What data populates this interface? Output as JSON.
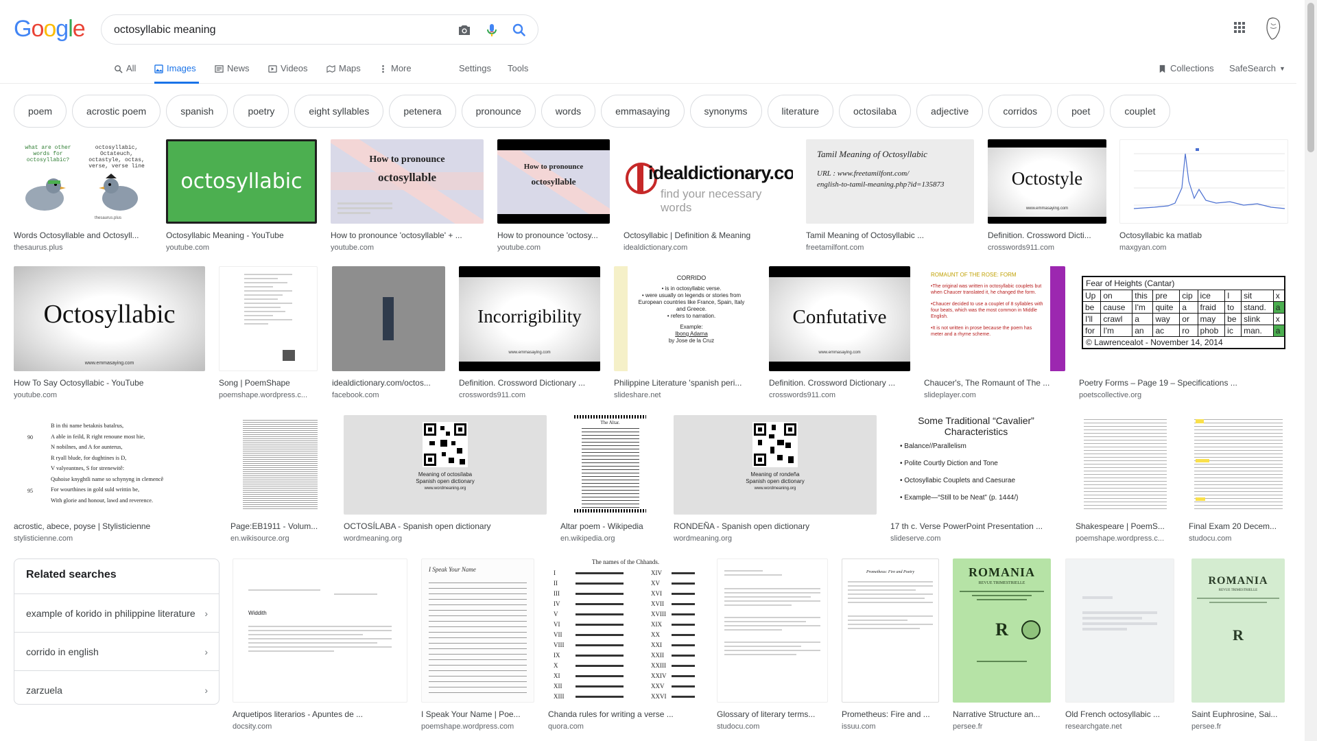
{
  "logo": {
    "g1": "G",
    "o1": "o",
    "o2": "o",
    "g2": "g",
    "l": "l",
    "e": "e"
  },
  "search": {
    "value": "octosyllabic meaning"
  },
  "tabs": [
    {
      "label": "All"
    },
    {
      "label": "Images"
    },
    {
      "label": "News"
    },
    {
      "label": "Videos"
    },
    {
      "label": "Maps"
    },
    {
      "label": "More"
    },
    {
      "label": "Settings"
    },
    {
      "label": "Tools"
    }
  ],
  "header_right": {
    "collections": "Collections",
    "safesearch": "SafeSearch"
  },
  "chips": [
    "poem",
    "acrostic poem",
    "spanish",
    "poetry",
    "eight syllables",
    "petenera",
    "pronounce",
    "words",
    "emmasaying",
    "synonyms",
    "literature",
    "octosilaba",
    "adjective",
    "corridos",
    "poet",
    "couplet"
  ],
  "row1": [
    {
      "title": "Words Octosyllable and Octosyll...",
      "source": "thesaurus.plus",
      "q1": "what are other words for octosyllabic?",
      "q2": "octosyllabic, Octateuch, octastyle, octas, verse, verse line",
      "foot": "thesaurus.plus"
    },
    {
      "title": "Octosyllabic Meaning - YouTube",
      "source": "youtube.com",
      "word": "octosyllabic"
    },
    {
      "title": "How to pronounce 'octosyllable' + ...",
      "source": "youtube.com",
      "line1": "How to pronounce",
      "line2": "octosyllable"
    },
    {
      "title": "How to pronounce 'octosy...",
      "source": "youtube.com",
      "line1": "How to pronounce",
      "line2": "octosyllable"
    },
    {
      "title": "Octosyllabic | Definition & Meaning",
      "source": "idealdictionary.com",
      "brand": "idealdictionary.com",
      "tagline": "find your necessary words"
    },
    {
      "title": "Tamil Meaning of Octosyllabic ...",
      "source": "freetamilfont.com",
      "l1": "Tamil Meaning of Octosyllabic",
      "l2": "URL : www.freetamilfont.com/",
      "l3": "english-to-tamil-meaning.php?id=135873"
    },
    {
      "title": "Definition. Crossword Dicti...",
      "source": "crosswords911.com",
      "word": "Octostyle",
      "foot": "www.emmasaying.com"
    },
    {
      "title": "Octosyllabic ka matlab",
      "source": "maxgyan.com"
    }
  ],
  "row2": [
    {
      "title": "How To Say Octosyllabic - YouTube",
      "source": "youtube.com",
      "word": "Octosyllabic",
      "foot": "www.emmasaying.com"
    },
    {
      "title": "Song | PoemShape",
      "source": "poemshape.wordpress.c..."
    },
    {
      "title": "idealdictionary.com/octos...",
      "source": "facebook.com"
    },
    {
      "title": "Definition. Crossword Dictionary ...",
      "source": "crosswords911.com",
      "word": "Incorrigibility",
      "foot": "www.emmasaying.com"
    },
    {
      "title": "Philippine Literature 'spanish peri...",
      "source": "slideshare.net",
      "head": "CORRIDO",
      "b1": "• is in octosyllabic verse.",
      "b2": "• were usually on legends or stories from European countries like France, Spain, Italy and Greece.",
      "b3": "• refers to narration.",
      "ex": "Example:",
      "ex2": "Ibong Adarna",
      "ex3": "by Jose de la Cruz"
    },
    {
      "title": "Definition. Crossword Dictionary ...",
      "source": "crosswords911.com",
      "word": "Confutative",
      "foot": "www.emmasaying.com"
    },
    {
      "title": "Chaucer's, The Romaunt of The ...",
      "source": "slideplayer.com",
      "head": "ROMAUNT OF THE ROSE: FORM",
      "b1": "•The original was written in octosyllabic couplets but when Chaucer translated it, he changed the form.",
      "b2": "•Chaucer decided to use a couplet of 8 syllables with four beats, which was the most common in Middle English.",
      "b3": "•It is not written in prose because the poem has meter and a rhyme scheme."
    },
    {
      "title": "Poetry Forms – Page 19 – Specifications ...",
      "source": "poetscollective.org",
      "head": "Fear of Heights  (Cantar)",
      "grid": [
        [
          "Up",
          "on",
          "this",
          "pre",
          "cip",
          "ice",
          "I",
          "sit",
          "x"
        ],
        [
          "be",
          "cause",
          "I'm",
          "quite",
          "a",
          "fraid",
          "to",
          "stand.",
          "a"
        ],
        [
          "I'll",
          "crawl",
          "a",
          "way",
          "or",
          "may",
          "be",
          "slink",
          "x"
        ],
        [
          "for",
          "I'm",
          "an",
          "ac",
          "ro",
          "phob",
          "ic",
          "man.",
          "a"
        ]
      ],
      "foot": "© Lawrencealot - November 14, 2014"
    }
  ],
  "row3": [
    {
      "title": "acrostic, abece, poyse | Stylisticienne",
      "source": "stylisticienne.com",
      "lines": [
        "B in thi name betaknis batalrus,",
        "A able in feild, R right renoune most hie,",
        "N nobilnes, and A for aunterus,",
        "R ryall blude, for dughtines is D,",
        "V valyeantnes, S for strenewitê:",
        "Quhoise knyghtli name so schynyng in clemencê",
        "For wourthines in gold suld writtin be,",
        "With glorie and honour, lawd and reverence."
      ],
      "n90": "90",
      "n95": "95"
    },
    {
      "title": "Page:EB1911 - Volum...",
      "source": "en.wikisource.org"
    },
    {
      "title": "OCTOSÍLABA - Spanish open dictionary",
      "source": "wordmeaning.org",
      "cap1": "Meaning of octosílaba",
      "cap2": "Spanish open dictionary",
      "cap3": "www.wordmeaning.org"
    },
    {
      "title": "Altar poem - Wikipedia",
      "source": "en.wikipedia.org",
      "head": "The Altar."
    },
    {
      "title": "RONDEÑA - Spanish open dictionary",
      "source": "wordmeaning.org",
      "cap1": "Meaning of rondeña",
      "cap2": "Spanish open dictionary",
      "cap3": "www.wordmeaning.org"
    },
    {
      "title": "17 th c. Verse PowerPoint Presentation ...",
      "source": "slideserve.com",
      "head": "Some Traditional “Cavalier” Characteristics",
      "b1": "Balance//Parallelism",
      "b2": "Polite Courtly Diction and Tone",
      "b3": "Octosyllabic Couplets and Caesurae",
      "b4": "Example—“Still to be Neat” (p. 1444/)"
    },
    {
      "title": "Shakespeare | PoemS...",
      "source": "poemshape.wordpress.c..."
    },
    {
      "title": "Final Exam 20 Decem...",
      "source": "studocu.com"
    }
  ],
  "related": {
    "heading": "Related searches",
    "items": [
      "example of korido in philippine literature",
      "corrido in english",
      "zarzuela"
    ]
  },
  "row4": [
    {
      "title": "Arquetipos literarios - Apuntes de ...",
      "source": "docsity.com",
      "h": "Widdith"
    },
    {
      "title": "I Speak Your Name | Poe...",
      "source": "poemshape.wordpress.com",
      "head": "I Speak Your Name"
    },
    {
      "title": "Chanda rules for writing a verse ...",
      "source": "quora.com",
      "head": "The names of the Chhands.",
      "left": [
        "I",
        "II",
        "III",
        "IV",
        "V",
        "VI",
        "VII",
        "VIII",
        "IX",
        "X",
        "XI",
        "XII",
        "XIII"
      ],
      "right": [
        "XIV",
        "XV",
        "XVI",
        "XVII",
        "XVIII",
        "XIX",
        "XX",
        "XXI",
        "XXII",
        "XXIII",
        "XXIV",
        "XXV",
        "XXVI"
      ]
    },
    {
      "title": "Glossary of literary terms...",
      "source": "studocu.com"
    },
    {
      "title": "Prometheus: Fire and ...",
      "source": "issuu.com",
      "head": "Prometheus: Fire and Poetry"
    },
    {
      "title": "Narrative Structure an...",
      "source": "persee.fr",
      "mast": "ROMANIA",
      "sub": "REVUE TRIMESTRIELLE",
      "letter": "R"
    },
    {
      "title": "Old French octosyllabic ...",
      "source": "researchgate.net"
    },
    {
      "title": "Saint Euphrosine, Sai...",
      "source": "persee.fr",
      "mast": "ROMANIA",
      "sub": "REVUE TRIMESTRIELLE",
      "letter": "R"
    }
  ],
  "colors": {
    "blue": "#4285f4",
    "red": "#ea4335",
    "yellow": "#fbbc05",
    "green": "#34a853",
    "accent": "#1a73e8"
  }
}
